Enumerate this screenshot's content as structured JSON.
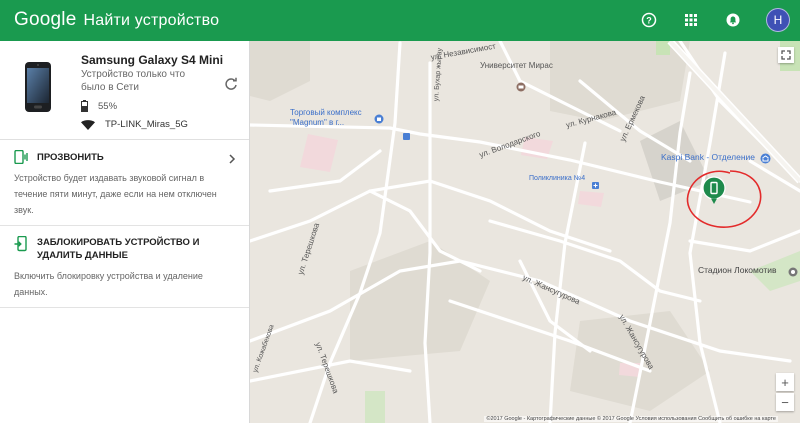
{
  "header": {
    "brand": "Google",
    "title": "Найти устройство",
    "avatar_letter": "Н",
    "icons": [
      "help-icon",
      "apps-grid-icon",
      "notifications-icon"
    ]
  },
  "device": {
    "name": "Samsung Galaxy S4 Mini",
    "status": "Устройство только что было в Сети",
    "battery": "55%",
    "wifi": "TP-LINK_Miras_5G"
  },
  "actions": [
    {
      "title": "ПРОЗВОНИТЬ",
      "description": "Устройство будет издавать звуковой сигнал в течение пяти минут, даже если на нем отключен звук."
    },
    {
      "title": "ЗАБЛОКИРОВАТЬ УСТРОЙСТВО И УДАЛИТЬ ДАННЫЕ",
      "description": "Включить блокировку устройства и удаление данных."
    }
  ],
  "map": {
    "labels": {
      "university": "Университет Мирас",
      "mall": "Торговый комплекс \"Magnum\" в г...",
      "kaspi": "Kaspi Bank - Отделение",
      "clinic": "Поликлиника №4",
      "stadium": "Стадион Локомотив",
      "str_volodarskogo": "ул. Володарского",
      "str_kurnakova": "ул. Курнакова",
      "str_ermekova": "ул. Ермекова",
      "str_zhansugurova": "ул. Жансугурова",
      "str_zhansugurova2": "ул. Жансугурова",
      "str_tereshkova": "ул. Терешкова",
      "str_tereshkova2": "ул. Терешкова",
      "str_nezavisimosti": "ул. Независимост",
      "str_bukhar": "ул. Бухар жырау",
      "str_kozhabekova": "ул. Кожабекова"
    },
    "zoom_in": "+",
    "zoom_out": "−",
    "footer": "©2017 Google - Картографические данные © 2017 Google    Условия использования    Сообщить об ошибке на карте"
  },
  "colors": {
    "header_bg": "#1a9a4f",
    "marker": "#1e8a4c",
    "circle": "#e32b2b",
    "poi_blue": "#3d6fc6"
  }
}
